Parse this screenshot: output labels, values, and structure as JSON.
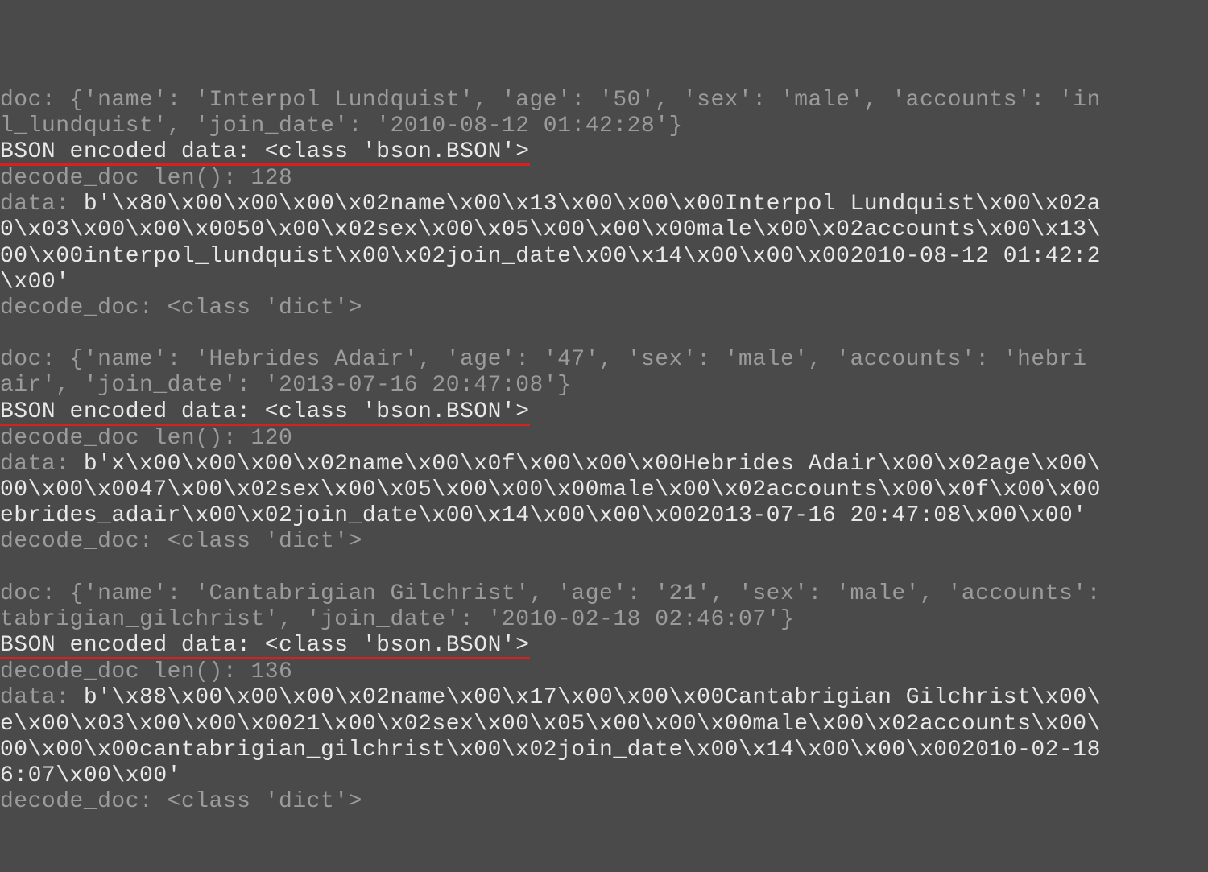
{
  "blocks": [
    {
      "doc": "doc: {'name': 'Interpol Lundquist', 'age': '50', 'sex': 'male', 'accounts': 'in\nl_lundquist', 'join_date': '2010-08-12 01:42:28'}",
      "encoded": "BSON encoded data: <class 'bson.BSON'>",
      "len": "decode_doc len(): 128",
      "data_prefix": "data: ",
      "data": "b'\\x80\\x00\\x00\\x00\\x02name\\x00\\x13\\x00\\x00\\x00Interpol Lundquist\\x00\\x02a\n0\\x03\\x00\\x00\\x0050\\x00\\x02sex\\x00\\x05\\x00\\x00\\x00male\\x00\\x02accounts\\x00\\x13\\\n00\\x00interpol_lundquist\\x00\\x02join_date\\x00\\x14\\x00\\x00\\x002010-08-12 01:42:2\n\\x00'",
      "decode": "decode_doc: <class 'dict'>"
    },
    {
      "doc": "doc: {'name': 'Hebrides Adair', 'age': '47', 'sex': 'male', 'accounts': 'hebri\nair', 'join_date': '2013-07-16 20:47:08'}",
      "encoded": "BSON encoded data: <class 'bson.BSON'>",
      "len": "decode_doc len(): 120",
      "data_prefix": "data: ",
      "data": "b'x\\x00\\x00\\x00\\x02name\\x00\\x0f\\x00\\x00\\x00Hebrides Adair\\x00\\x02age\\x00\\\n00\\x00\\x0047\\x00\\x02sex\\x00\\x05\\x00\\x00\\x00male\\x00\\x02accounts\\x00\\x0f\\x00\\x00\nebrides_adair\\x00\\x02join_date\\x00\\x14\\x00\\x00\\x002013-07-16 20:47:08\\x00\\x00'",
      "decode": "decode_doc: <class 'dict'>"
    },
    {
      "doc": "doc: {'name': 'Cantabrigian Gilchrist', 'age': '21', 'sex': 'male', 'accounts':\ntabrigian_gilchrist', 'join_date': '2010-02-18 02:46:07'}",
      "encoded": "BSON encoded data: <class 'bson.BSON'>",
      "len": "decode_doc len(): 136",
      "data_prefix": "data: ",
      "data": "b'\\x88\\x00\\x00\\x00\\x02name\\x00\\x17\\x00\\x00\\x00Cantabrigian Gilchrist\\x00\\\ne\\x00\\x03\\x00\\x00\\x0021\\x00\\x02sex\\x00\\x05\\x00\\x00\\x00male\\x00\\x02accounts\\x00\\\n00\\x00\\x00cantabrigian_gilchrist\\x00\\x02join_date\\x00\\x14\\x00\\x00\\x002010-02-18\n6:07\\x00\\x00'",
      "decode": "decode_doc: <class 'dict'>"
    }
  ]
}
